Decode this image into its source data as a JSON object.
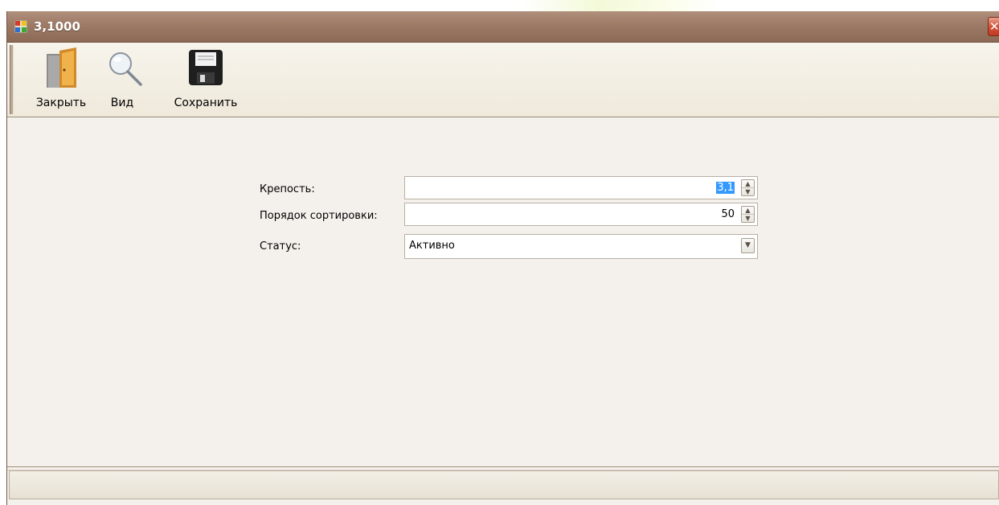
{
  "window": {
    "title": "3,1000",
    "icon": "app-window-icon",
    "close_symbol": "✕"
  },
  "toolbar": {
    "close_label": "Закрыть",
    "close_icon": "door-icon",
    "view_label": "Вид",
    "view_icon": "magnifier-icon",
    "save_label": "Сохранить",
    "save_icon": "floppy-disk-icon"
  },
  "form": {
    "strength_label": "Крепость:",
    "strength_value": "3,1",
    "sort_order_label": "Порядок сортировки:",
    "sort_order_value": "50",
    "status_label": "Статус:",
    "status_value": "Активно"
  },
  "colors": {
    "titlebar": "#9c7a66",
    "window_bg": "#f4f1ec",
    "selection": "#3399ff",
    "close_button": "#d2553a"
  }
}
